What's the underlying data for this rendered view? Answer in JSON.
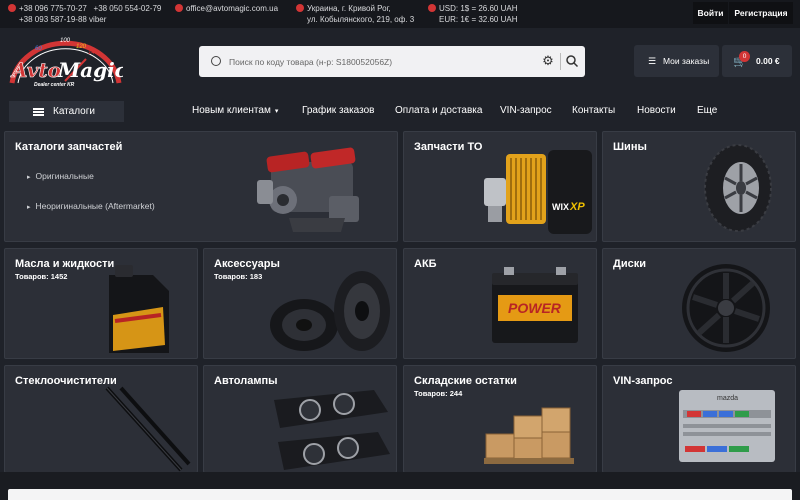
{
  "topbar": {
    "phone1": "+38 096 775-70-27",
    "phone2": "+38 050 554-02-79",
    "phone3": "+38 093 587-19-88 viber",
    "email": "office@avtomagic.com.ua",
    "address_line1": "Украина, г. Кривой Рог,",
    "address_line2": "ул. Кобылянского, 219, оф. 3",
    "rate_usd": "USD: 1$ = 26.60 UAH",
    "rate_eur": "EUR: 1€ = 32.60 UAH",
    "login": "Войти",
    "register": "Регистрация"
  },
  "logo": {
    "brand_part1": "Avto",
    "brand_part2": "Magic",
    "tagline": "Dealer center KR",
    "scale_marks": [
      "60",
      "100",
      "120",
      "140"
    ]
  },
  "search": {
    "placeholder": "Поиск по коду товара (н-р: S180052056Z)"
  },
  "header": {
    "orders": "Мои заказы",
    "cart_count": "0",
    "cart_total": "0.00 €"
  },
  "nav": {
    "catalogs": "Каталоги",
    "links": [
      "Новым клиентам",
      "График заказов",
      "Оплата и доставка",
      "VIN-запрос",
      "Контакты",
      "Новости",
      "Еще"
    ]
  },
  "tiles": {
    "catalogs": {
      "title": "Каталоги запчастей",
      "link1": "Оригинальные",
      "link2": "Неоригинальные (Aftermarket)"
    },
    "to_parts": {
      "title": "Запчасти ТО",
      "filter_brand": "WIX",
      "filter_model": "XP"
    },
    "tires": {
      "title": "Шины"
    },
    "oils": {
      "title": "Масла и жидкости",
      "count": "Товаров: 1452"
    },
    "accessories": {
      "title": "Аксессуары",
      "count": "Товаров: 183"
    },
    "battery": {
      "title": "АКБ",
      "label": "POWER"
    },
    "wheels": {
      "title": "Диски"
    },
    "wipers": {
      "title": "Стеклоочистители"
    },
    "lamps": {
      "title": "Автолампы"
    },
    "stock": {
      "title": "Складские остатки",
      "count": "Товаров: 244"
    },
    "vin": {
      "title": "VIN-запрос",
      "plate_brand": "mazda"
    }
  },
  "colors": {
    "background": "#1f2229",
    "tile": "#2c2f37",
    "accent_red": "#d23535"
  }
}
